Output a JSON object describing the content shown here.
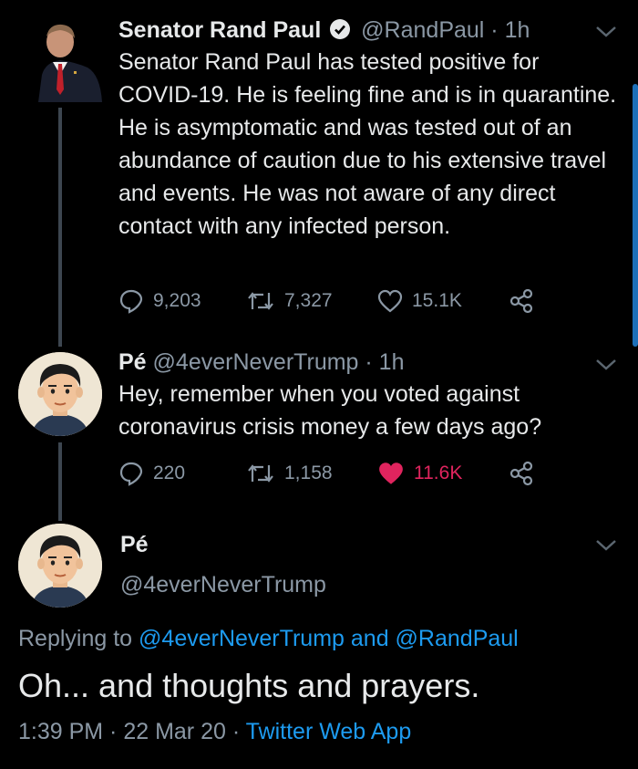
{
  "tweet1": {
    "name": "Senator Rand Paul",
    "handle": "@RandPaul",
    "sep": " · ",
    "time": "1h",
    "text": "Senator Rand Paul has tested positive for COVID-19. He is feeling fine and is in quarantine. He is asymptomatic and was tested out of an abundance of caution due to his extensive travel and events. He was not aware of any direct contact with any infected person.",
    "replies": "9,203",
    "retweets": "7,327",
    "likes": "15.1K"
  },
  "tweet2": {
    "name": "Pé",
    "handle": "@4everNeverTrump",
    "sep": " · ",
    "time": "1h",
    "text": "Hey, remember when you voted against coronavirus crisis money a few days ago?",
    "replies": "220",
    "retweets": "1,158",
    "likes": "11.6K",
    "like_color": "#e0245e"
  },
  "tweet3": {
    "name": "Pé",
    "handle": "@4everNeverTrump",
    "replying_prefix": "Replying to ",
    "replying_user1": "@4everNeverTrump",
    "replying_and": " and ",
    "replying_user2": "@RandPaul",
    "text": "Oh... and thoughts and prayers.",
    "time": "1:39 PM",
    "date": "22 Mar 20",
    "source": "Twitter Web App"
  },
  "colors": {
    "accent": "#1d9bf0",
    "muted": "#8b98a5",
    "background": "#000000"
  }
}
